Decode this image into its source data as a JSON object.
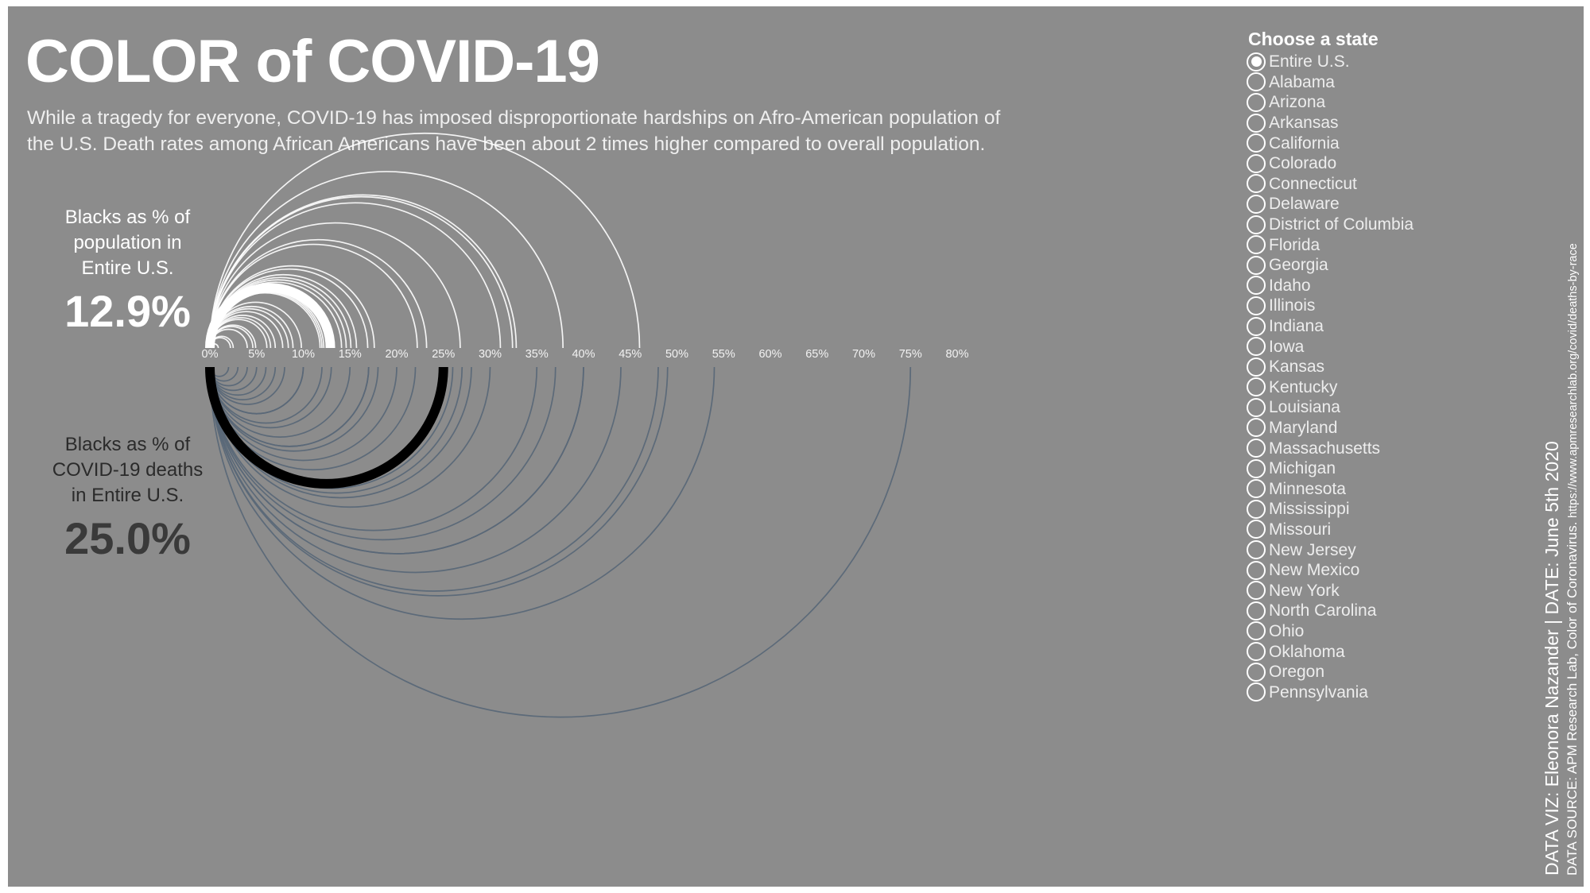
{
  "canvas": {
    "background": "#8c8c8c",
    "frame": "#ffffff"
  },
  "header": {
    "title": "COLOR of COVID-19",
    "subtitle_line1": "While a tragedy for everyone, COVID-19 has imposed disproportionate hardships on Afro-American population of",
    "subtitle_line2": "the U.S. Death rates among African Americans have been about 2 times higher compared to overall population."
  },
  "annotations": {
    "population": {
      "label_line1": "Blacks as % of",
      "label_line2": "population in",
      "label_line3": "Entire U.S.",
      "value": "12.9%",
      "color": "#ffffff"
    },
    "deaths": {
      "label_line1": "Blacks as % of",
      "label_line2": "COVID-19 deaths",
      "label_line3": "in Entire U.S.",
      "value": "25.0%",
      "color": "#333333"
    }
  },
  "axis": {
    "ticks": [
      "0%",
      "5%",
      "10%",
      "15%",
      "20%",
      "25%",
      "30%",
      "35%",
      "40%",
      "45%",
      "50%",
      "55%",
      "60%",
      "65%",
      "70%",
      "75%",
      "80%"
    ],
    "min": 0,
    "max": 80,
    "color": "#f2f2f2"
  },
  "sidebar": {
    "title": "Choose a state",
    "selected": "Entire U.S.",
    "items": [
      {
        "label": "Entire U.S.",
        "selected": true
      },
      {
        "label": "Alabama",
        "selected": false
      },
      {
        "label": "Arizona",
        "selected": false
      },
      {
        "label": "Arkansas",
        "selected": false
      },
      {
        "label": "California",
        "selected": false
      },
      {
        "label": "Colorado",
        "selected": false
      },
      {
        "label": "Connecticut",
        "selected": false
      },
      {
        "label": "Delaware",
        "selected": false
      },
      {
        "label": "District of Columbia",
        "selected": false
      },
      {
        "label": "Florida",
        "selected": false
      },
      {
        "label": "Georgia",
        "selected": false
      },
      {
        "label": "Idaho",
        "selected": false
      },
      {
        "label": "Illinois",
        "selected": false
      },
      {
        "label": "Indiana",
        "selected": false
      },
      {
        "label": "Iowa",
        "selected": false
      },
      {
        "label": "Kansas",
        "selected": false
      },
      {
        "label": "Kentucky",
        "selected": false
      },
      {
        "label": "Louisiana",
        "selected": false
      },
      {
        "label": "Maryland",
        "selected": false
      },
      {
        "label": "Massachusetts",
        "selected": false
      },
      {
        "label": "Michigan",
        "selected": false
      },
      {
        "label": "Minnesota",
        "selected": false
      },
      {
        "label": "Mississippi",
        "selected": false
      },
      {
        "label": "Missouri",
        "selected": false
      },
      {
        "label": "New Jersey",
        "selected": false
      },
      {
        "label": "New Mexico",
        "selected": false
      },
      {
        "label": "New York",
        "selected": false
      },
      {
        "label": "North Carolina",
        "selected": false
      },
      {
        "label": "Ohio",
        "selected": false
      },
      {
        "label": "Oklahoma",
        "selected": false
      },
      {
        "label": "Oregon",
        "selected": false
      },
      {
        "label": "Pennsylvania",
        "selected": false
      }
    ]
  },
  "credits": {
    "main": "DATA VIZ: Eleonora Nazander  |  DATE: June 5th 2020",
    "source_prefix": "DATA SOURCE: APM Research Lab, Color of Coronavirus. ",
    "source_url": "https://www.apmresearchlab.org/covid/deaths-by-race"
  },
  "chart_data": {
    "type": "arc",
    "title": "COLOR of COVID-19",
    "xlabel": "",
    "ylabel": "",
    "xlim": [
      0,
      80
    ],
    "grid": false,
    "legend": "none",
    "description": "Mirrored semicircular arc diagram. Upper (white) arcs encode Blacks as % of population per state; lower (dark slate) arcs encode Blacks as % of COVID-19 deaths per state. Each arc starts at 0% and its diameter spans to the state's value on the shared horizontal axis. Highlighted bold arcs are the Entire U.S. values.",
    "series": [
      {
        "name": "Blacks as % of population",
        "color": "#ffffff",
        "side": "upper",
        "highlight_value": 12.9,
        "categories": [
          "Entire U.S.",
          "Alabama",
          "Arizona",
          "Arkansas",
          "California",
          "Colorado",
          "Connecticut",
          "Delaware",
          "District of Columbia",
          "Florida",
          "Georgia",
          "Idaho",
          "Illinois",
          "Indiana",
          "Iowa",
          "Kansas",
          "Kentucky",
          "Louisiana",
          "Maryland",
          "Massachusetts",
          "Michigan",
          "Minnesota",
          "Mississippi",
          "Missouri",
          "New Jersey",
          "New Mexico",
          "New York",
          "North Carolina",
          "Ohio",
          "Oklahoma",
          "Oregon",
          "Pennsylvania"
        ],
        "values": [
          12.9,
          26.8,
          4.9,
          15.7,
          6.5,
          4.6,
          12.2,
          23.2,
          46.0,
          16.9,
          32.4,
          0.9,
          14.6,
          9.8,
          4.0,
          6.1,
          8.4,
          32.8,
          31.1,
          8.9,
          14.1,
          7.0,
          37.8,
          11.8,
          15.1,
          2.5,
          17.6,
          22.2,
          13.0,
          7.8,
          2.2,
          12.0
        ]
      },
      {
        "name": "Blacks as % of COVID-19 deaths",
        "color": "#5a6878",
        "side": "lower",
        "highlight_value": 25.0,
        "categories": [
          "Entire U.S.",
          "Alabama",
          "Arizona",
          "Arkansas",
          "California",
          "Colorado",
          "Connecticut",
          "Delaware",
          "District of Columbia",
          "Florida",
          "Georgia",
          "Idaho",
          "Illinois",
          "Indiana",
          "Iowa",
          "Kansas",
          "Kentucky",
          "Louisiana",
          "Maryland",
          "Massachusetts",
          "Michigan",
          "Minnesota",
          "Mississippi",
          "Missouri",
          "New Jersey",
          "New Mexico",
          "New York",
          "North Carolina",
          "Ohio",
          "Oklahoma",
          "Oregon",
          "Pennsylvania"
        ],
        "values": [
          25.0,
          44.0,
          5.0,
          37.0,
          8.0,
          7.0,
          17.0,
          25.0,
          75.0,
          17.0,
          48.0,
          2.0,
          30.0,
          18.0,
          6.0,
          13.0,
          15.0,
          54.0,
          40.0,
          10.0,
          40.0,
          10.0,
          49.0,
          26.0,
          20.0,
          3.0,
          22.0,
          35.0,
          28.0,
          12.0,
          4.0,
          27.0
        ]
      }
    ]
  }
}
